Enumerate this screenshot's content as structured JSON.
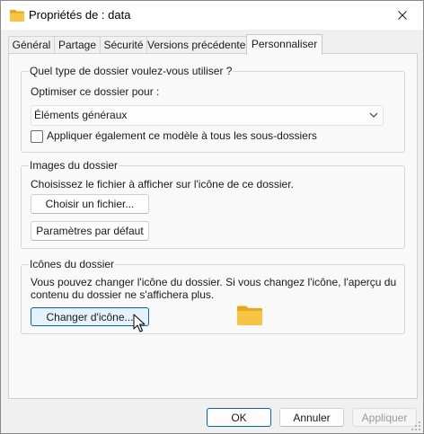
{
  "window": {
    "title": "Propriétés de : data"
  },
  "tabs": [
    {
      "label": "Général",
      "active": false
    },
    {
      "label": "Partage",
      "active": false
    },
    {
      "label": "Sécurité",
      "active": false
    },
    {
      "label": "Versions précédentes",
      "active": false
    },
    {
      "label": "Personnaliser",
      "active": true
    }
  ],
  "folder_type": {
    "title": "Quel type de dossier voulez-vous utiliser ?",
    "optimize_label": "Optimiser ce dossier pour :",
    "select_value": "Éléments généraux",
    "apply_checkbox_label": "Appliquer également ce modèle à tous les sous-dossiers",
    "apply_checked": false
  },
  "folder_images": {
    "title": "Images du dossier",
    "description": "Choisissez le fichier à afficher sur l'icône de ce dossier.",
    "choose_file_button": "Choisir un fichier...",
    "default_settings_button": "Paramètres par défaut"
  },
  "folder_icons": {
    "title": "Icônes du dossier",
    "description_line1": "Vous pouvez changer l'icône du dossier. Si vous changez l'icône, l'aperçu du",
    "description_line2": "contenu du dossier ne s'affichera plus.",
    "change_icon_button": "Changer d'icône..."
  },
  "footer": {
    "ok_button": "OK",
    "cancel_button": "Annuler",
    "apply_button": "Appliquer"
  },
  "colors": {
    "accent": "#0067c0",
    "folder": "#f8c443",
    "window_bg": "#f0f0f0",
    "panel_bg": "#f9f9f9"
  },
  "icons": [
    "folder-icon",
    "close-icon",
    "chevron-down-icon",
    "mouse-cursor-icon",
    "resize-grip-icon"
  ]
}
